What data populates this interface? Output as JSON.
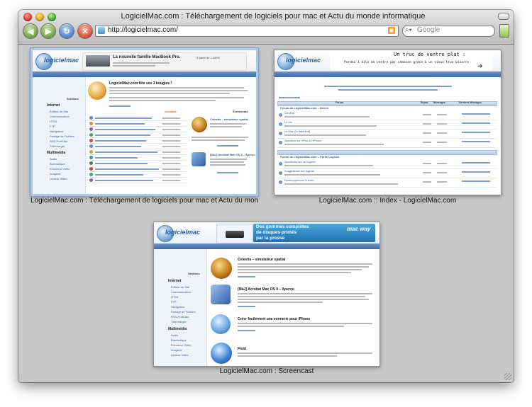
{
  "window": {
    "title": "LogicielMac.com : Téléchargement de logiciels pour mac et Actu du monde informatique"
  },
  "toolbar": {
    "url": "http://logicielmac.com/",
    "search_placeholder": "Google",
    "back_icon": "arrow-left-icon",
    "forward_icon": "arrow-right-icon",
    "reload_icon": "reload-icon",
    "stop_icon": "stop-icon"
  },
  "tabs": [
    {
      "caption": "LogicielMac.com : Téléchargement de logiciels pour mac et Actu du monde infor…",
      "selected": true
    },
    {
      "caption": "LogicielMac.com :: Index - LogicielMac.com",
      "selected": false
    },
    {
      "caption": "LogicielMac.com : Screencast",
      "selected": false
    }
  ],
  "thumb1": {
    "logo": "logicielmac",
    "banner_title": "La nouvelle famille MacBook Pro.",
    "banner_price": "À partir de 1 449 €",
    "headline": "LogicielMac.com fête ses 3 bougies !",
    "sidebar_section": "Sections",
    "side_internet": "Internet",
    "side_items_internet": [
      "Éditeur de Site",
      "Communication",
      "HTML",
      "FTP",
      "Navigateur",
      "Partage de Fichiers",
      "RSS-PodCast",
      "Télécharger"
    ],
    "side_multimedia": "Multimédia",
    "side_items_multimedia": [
      "Audio",
      "Bureautique",
      "Encodeur Vidéo",
      "Imagerie",
      "Lecteur Vidéo"
    ],
    "col_actualite": "Actualité",
    "col_screencast": "Screencast",
    "screencast_1": "Celestia – simulateur spatial",
    "screencast_2": "[MàJ] Acrobat Mac OS 9 – Aperçu"
  },
  "thumb2": {
    "banner_text_1": "Un truc de ventre plat :",
    "banner_text_2": "Perdez 1 kilo de ventre par semaine grâce à un vieux truc bizarre",
    "forum_section_1": "Forum de LogicielMac.com – Divers",
    "forum_section_2": "Forum de LogicielMac.com – Partie Logiciel",
    "col_forum": "Forum",
    "col_sujets": "Sujets",
    "col_messages": "Messages",
    "col_derniers": "Derniers Messages",
    "forums": [
      "Général",
      "La vie",
      "Le Mac (la machine)",
      "Question sur l'iPod & l'iPhone",
      "Questions sur un logiciel",
      "Suggestions sur logiciel",
      "Développement & tests"
    ]
  },
  "thumb3": {
    "ad_line_1": "Des gommes complètes",
    "ad_line_2": "de disques primés",
    "ad_line_3": "par la presse",
    "ad_brand": "mac way",
    "sidebar_section": "Sections",
    "side_internet": "Internet",
    "side_items_internet": [
      "Éditeur de Site",
      "Communication",
      "HTML",
      "FTP",
      "Navigateur",
      "Partage de Fichiers",
      "RSS-PodCast",
      "Télécharger"
    ],
    "side_multimedia": "Multimédia",
    "side_items_multimedia": [
      "Audio",
      "Bureautique",
      "Encodeur Vidéo",
      "Imagerie",
      "Lecteur Vidéo"
    ],
    "articles": [
      "Celestia – simulateur spatial",
      "[MàJ] Acrobat Mac OS 9 – Aperçu",
      "Créer facilement une sonnerie pour iPhone",
      "Fluid"
    ]
  }
}
